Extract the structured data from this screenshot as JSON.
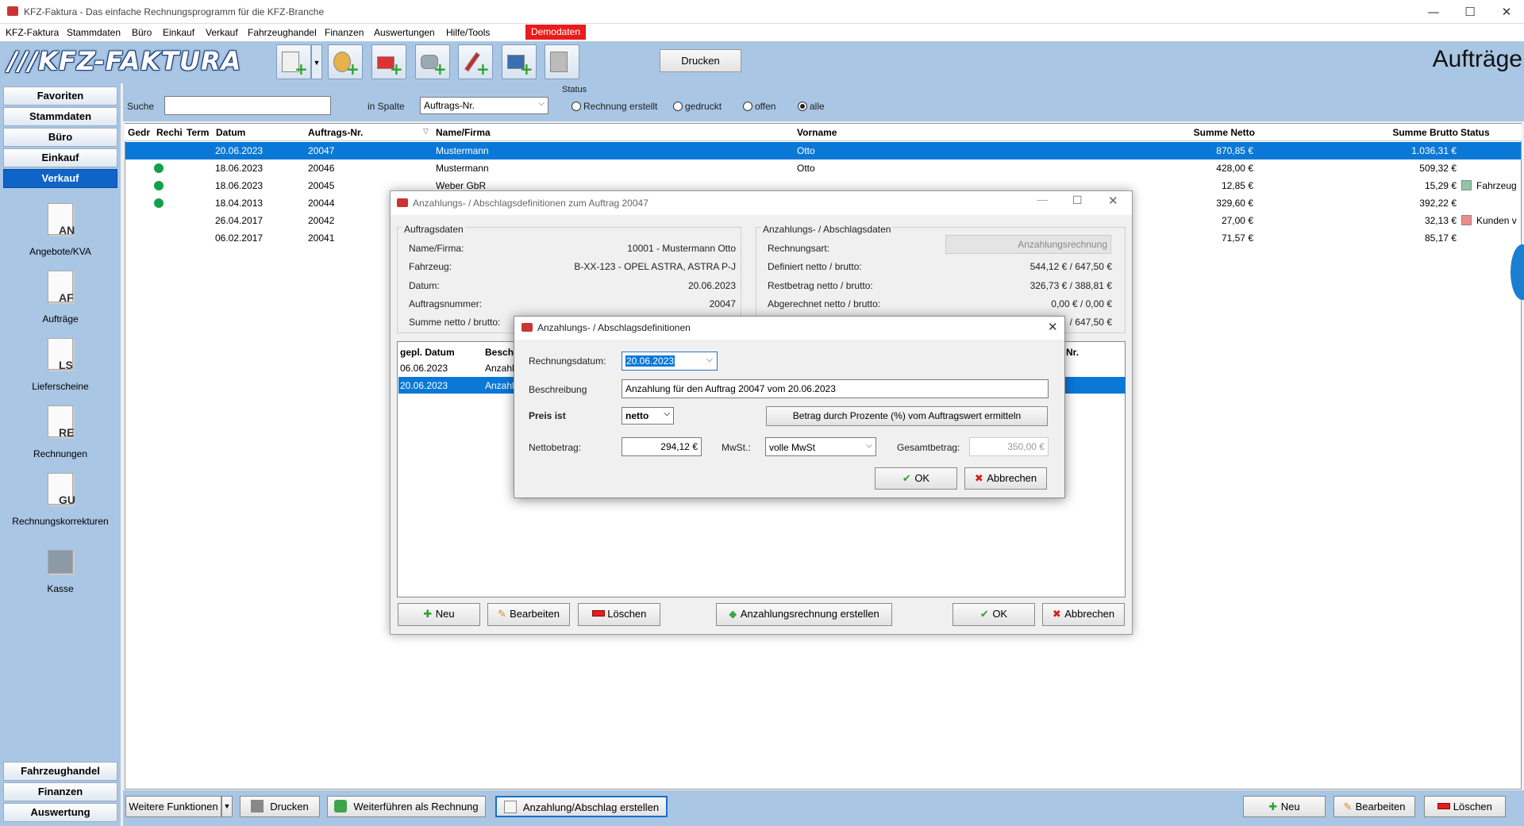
{
  "window": {
    "title": "KFZ-Faktura - Das einfache Rechnungsprogramm für die KFZ-Branche",
    "min": "—",
    "max": "☐",
    "close": "✕"
  },
  "menu": [
    "KFZ-Faktura",
    "Stammdaten",
    "Büro",
    "Einkauf",
    "Verkauf",
    "Fahrzeughandel",
    "Finanzen",
    "Auswertungen",
    "Hilfe/Tools"
  ],
  "demo_badge": "Demodaten",
  "toolbar": {
    "logo": "///KFZ-FAKTURA",
    "print": "Drucken",
    "page_title": "Aufträge"
  },
  "sidebar": {
    "top": [
      "Favoriten",
      "Stammdaten",
      "Büro",
      "Einkauf",
      "Verkauf"
    ],
    "modules": [
      {
        "code": "AN",
        "label": "Angebote/KVA"
      },
      {
        "code": "AF",
        "label": "Aufträge"
      },
      {
        "code": "LS",
        "label": "Lieferscheine"
      },
      {
        "code": "RE",
        "label": "Rechnungen"
      },
      {
        "code": "GU",
        "label": "Rechnungskorrekturen"
      },
      {
        "code": "",
        "label": "Kasse"
      }
    ],
    "bottom": [
      "Fahrzeughandel",
      "Finanzen",
      "Auswertung"
    ]
  },
  "filter": {
    "search_label": "Suche",
    "search_value": "",
    "column_label": "in Spalte",
    "column_value": "Auftrags-Nr.",
    "status_label": "Status",
    "radios": [
      "Rechnung erstellt",
      "gedruckt",
      "offen",
      "alle"
    ],
    "selected": "alle"
  },
  "grid": {
    "headers": [
      "Gedr",
      "Rechi",
      "Term",
      "Datum",
      "Auftrags-Nr.",
      "Name/Firma",
      "Vorname",
      "Summe Netto",
      "Summe Brutto",
      "Status"
    ],
    "rows": [
      {
        "dot": false,
        "datum": "20.06.2023",
        "nr": "20047",
        "name": "Mustermann",
        "vorname": "Otto",
        "netto": "870,85 €",
        "brutto": "1.036,31 €",
        "status": "",
        "sel": true
      },
      {
        "dot": true,
        "datum": "18.06.2023",
        "nr": "20046",
        "name": "Mustermann",
        "vorname": "Otto",
        "netto": "428,00 €",
        "brutto": "509,32 €",
        "status": ""
      },
      {
        "dot": true,
        "datum": "18.06.2023",
        "nr": "20045",
        "name": "Weber GbR",
        "vorname": "",
        "netto": "12,85 €",
        "brutto": "15,29 €",
        "status": "Fahrzeug",
        "sq": "#8fc7a6"
      },
      {
        "dot": true,
        "datum": "18.04.2013",
        "nr": "20044",
        "name": "",
        "vorname": "",
        "netto": "329,60 €",
        "brutto": "392,22 €",
        "status": ""
      },
      {
        "dot": false,
        "datum": "26.04.2017",
        "nr": "20042",
        "name": "",
        "vorname": "",
        "netto": "27,00 €",
        "brutto": "32,13 €",
        "status": "Kunden v",
        "sq": "#f08a8a"
      },
      {
        "dot": false,
        "datum": "06.02.2017",
        "nr": "20041",
        "name": "",
        "vorname": "",
        "netto": "71,57 €",
        "brutto": "85,17 €",
        "status": ""
      }
    ]
  },
  "bottom": {
    "weitere": "Weitere Funktionen",
    "drucken": "Drucken",
    "weiter": "Weiterführen als Rechnung",
    "anzahlung": "Anzahlung/Abschlag erstellen",
    "neu": "Neu",
    "bearbeiten": "Bearbeiten",
    "loeschen": "Löschen"
  },
  "dlg1": {
    "title": "Anzahlungs- / Abschlagsdefinitionen zum Auftrag 20047",
    "auftrag_group": "Auftragsdaten",
    "auftrag": [
      [
        "Name/Firma:",
        "10001 - Mustermann Otto"
      ],
      [
        "Fahrzeug:",
        "B-XX-123 - OPEL ASTRA, ASTRA P-J"
      ],
      [
        "Datum:",
        "20.06.2023"
      ],
      [
        "Auftragsnummer:",
        "20047"
      ],
      [
        "Summe netto / brutto:",
        ""
      ]
    ],
    "anz_group": "Anzahlungs- / Abschlagsdaten",
    "anz": [
      [
        "Rechnungsart:",
        "Anzahlungsrechnung"
      ],
      [
        "Definiert netto / brutto:",
        "544,12 € / 647,50 €"
      ],
      [
        "Restbetrag netto / brutto:",
        "326,73 € / 388,81 €"
      ],
      [
        "Abgerechnet netto / brutto:",
        "0,00 € / 0,00 €"
      ],
      [
        "",
        "/ 647,50 €"
      ]
    ],
    "list_headers": [
      "gepl. Datum",
      "Beschr",
      "Nr."
    ],
    "list_rows": [
      [
        "06.06.2023",
        "Anzahl"
      ],
      [
        "20.06.2023",
        "Anzahl"
      ]
    ],
    "neu": "Neu",
    "bearbeiten": "Bearbeiten",
    "loeschen": "Löschen",
    "erstellen": "Anzahlungsrechnung erstellen",
    "ok": "OK",
    "abbrechen": "Abbrechen"
  },
  "dlg2": {
    "title": "Anzahlungs- / Abschlagsdefinitionen",
    "datum_label": "Rechnungsdatum:",
    "datum": "20.06.2023",
    "beschr_label": "Beschreibung",
    "beschr": "Anzahlung für den Auftrag 20047 vom 20.06.2023",
    "preis_label": "Preis ist",
    "preis": "netto",
    "prozent_btn": "Betrag durch Prozente (%) vom Auftragswert ermitteln",
    "netto_label": "Nettobetrag:",
    "netto": "294,12 €",
    "mwst_label": "MwSt.:",
    "mwst": "volle MwSt",
    "gesamt_label": "Gesamtbetrag:",
    "gesamt": "350,00 €",
    "ok": "OK",
    "abbrechen": "Abbrechen"
  }
}
